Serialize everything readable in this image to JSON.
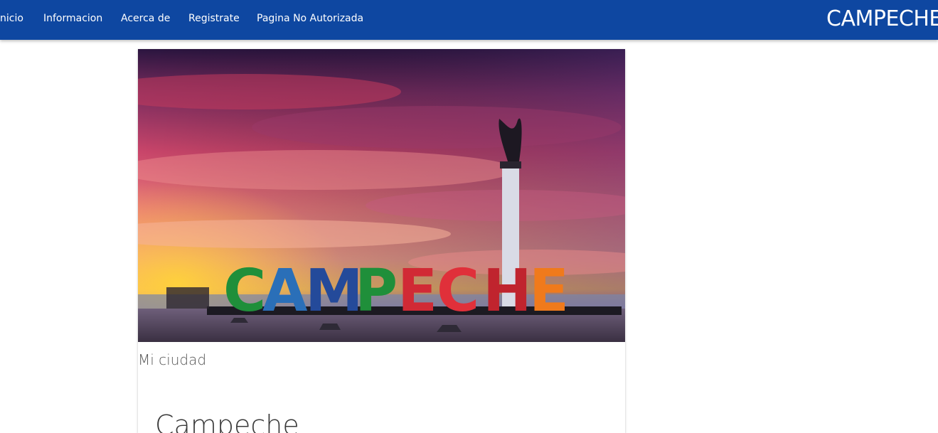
{
  "nav": {
    "items": [
      {
        "label": "nicio"
      },
      {
        "label": "Informacion"
      },
      {
        "label": "Acerca de"
      },
      {
        "label": "Registrate"
      },
      {
        "label": "Pagina No Autorizada"
      }
    ],
    "brand": "CAMPECHE"
  },
  "card": {
    "image_alt": "CAMPECHE",
    "image_sign_text": "CAMPECHE",
    "caption": "Mi ciudad",
    "title": "Campeche"
  },
  "colors": {
    "navbar": "#0e47a1",
    "nav_text": "#ffffff",
    "body_background": "#ffffff"
  }
}
